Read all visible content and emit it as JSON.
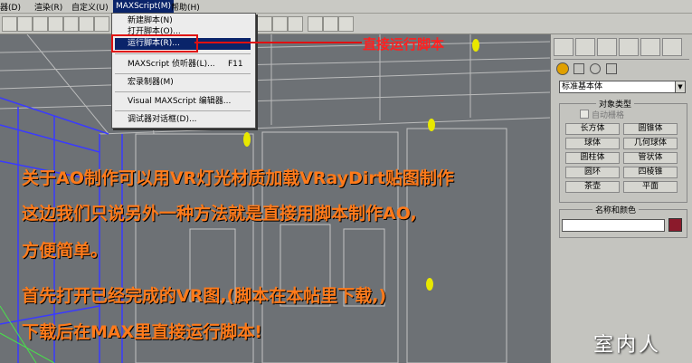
{
  "menubar": {
    "items": [
      "器(D)",
      "渲染(R)",
      "自定义(U)",
      "MAXScript(M)",
      "帮助(H)"
    ]
  },
  "dropdown": {
    "items": [
      "新建脚本(N)",
      "打开脚本(O)...",
      "运行脚本(R)...",
      "MAXScript 侦听器(L)...",
      "F11",
      "宏录制器(M)",
      "Visual MAXScript 编辑器...",
      "调试器对话框(D)..."
    ]
  },
  "callout": {
    "label": "直接运行脚本"
  },
  "panel": {
    "dropdown_value": "标准基本体",
    "rollout_object_type": "对象类型",
    "autogrid_label": "自动栅格",
    "buttons": [
      "长方体",
      "圆锥体",
      "球体",
      "几何球体",
      "圆柱体",
      "管状体",
      "圆环",
      "四棱锥",
      "茶壶",
      "平面"
    ],
    "rollout_name_color": "名称和颜色"
  },
  "annotation": {
    "lines": [
      "关于AO制作可以用VR灯光材质加载VRayDirt贴图制作",
      "这边我们只说另外一种方法就是直接用脚本制作AO,",
      "方便简单。",
      "首先打开已经完成的VR图,(脚本在本帖里下载,)",
      "下载后在MAX里直接运行脚本!"
    ]
  },
  "watermark": {
    "text": "室内人"
  },
  "colors": {
    "menu_highlight": "#0a246a",
    "callout_red": "#e01010",
    "annotation_orange": "#ff7a1a",
    "wireframe_yellow": "#e8e800",
    "name_swatch": "#8b1a2b"
  }
}
